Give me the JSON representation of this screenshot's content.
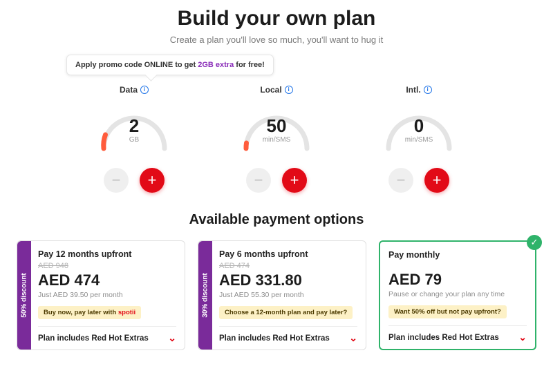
{
  "header": {
    "title": "Build your own plan",
    "subtitle": "Create a plan you'll love so much, you'll want to hug it"
  },
  "promo": {
    "prefix": "Apply promo code ONLINE to get ",
    "highlight": "2GB extra",
    "suffix": " for free!"
  },
  "dials": [
    {
      "label": "Data",
      "value": "2",
      "unit": "GB",
      "fill": 0.12
    },
    {
      "label": "Local",
      "value": "50",
      "unit": "min/SMS",
      "fill": 0.05
    },
    {
      "label": "Intl.",
      "value": "0",
      "unit": "min/SMS",
      "fill": 0.0
    }
  ],
  "payments_heading": "Available payment options",
  "cards": [
    {
      "discount": "50% discount",
      "title": "Pay 12 months upfront",
      "strike": "AED 948",
      "price": "AED 474",
      "permonth": "Just AED 39.50 per month",
      "pill_prefix": "Buy now, pay later with ",
      "pill_brand": "spotii",
      "extras": "Plan includes Red Hot Extras"
    },
    {
      "discount": "30% discount",
      "title": "Pay 6 months upfront",
      "strike": "AED 474",
      "price": "AED 331.80",
      "permonth": "Just AED 55.30 per month",
      "pill": "Choose a 12-month plan and pay later?",
      "extras": "Plan includes Red Hot Extras"
    },
    {
      "title": "Pay monthly",
      "price": "AED 79",
      "permonth": "Pause or change your plan any time",
      "pill": "Want 50% off but not pay upfront?",
      "extras": "Plan includes Red Hot Extras",
      "selected": true
    }
  ]
}
